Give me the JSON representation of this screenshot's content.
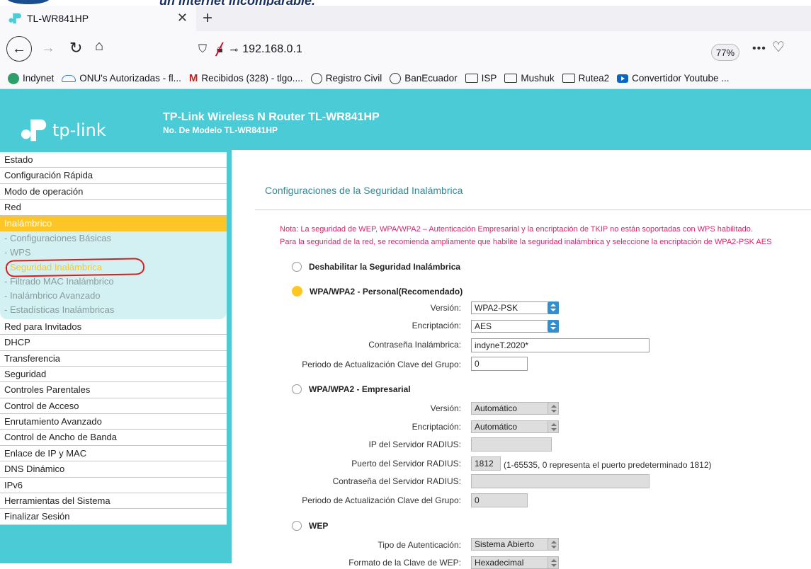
{
  "browser": {
    "tab_title": "TL-WR841HP",
    "url": "192.168.0.1",
    "zoom": "77%",
    "banner_text": "un internet incomparable."
  },
  "bookmarks": [
    {
      "label": "Indynet",
      "icon": "indynet-icon"
    },
    {
      "label": "ONU's Autorizadas - fl...",
      "icon": "onu-icon"
    },
    {
      "label": "Recibidos (328) - tlgo....",
      "icon": "gmail-icon"
    },
    {
      "label": "Registro Civil",
      "icon": "globe-icon"
    },
    {
      "label": "BanEcuador",
      "icon": "globe-icon"
    },
    {
      "label": "ISP",
      "icon": "folder-icon"
    },
    {
      "label": "Mushuk",
      "icon": "folder-icon"
    },
    {
      "label": "Rutea2",
      "icon": "folder-icon"
    },
    {
      "label": "Convertidor Youtube ...",
      "icon": "youtube-icon"
    }
  ],
  "header": {
    "logo_text": "tp-link",
    "title": "TP-Link Wireless N Router TL-WR841HP",
    "model": "No. De Modelo TL-WR841HP",
    "accent_color": "#4acbd6"
  },
  "sidebar": {
    "items_before": [
      "Estado",
      "Configuración Rápida",
      "Modo de operación",
      "Red"
    ],
    "active": "Inalámbrico",
    "subitems": [
      "- Configuraciones Básicas",
      "- WPS",
      "- Seguridad Inalámbrica",
      "- Filtrado MAC Inalámbrico",
      "- Inalámbrico Avanzado",
      "- Estadísticas Inalámbricas"
    ],
    "items_after": [
      "Red para Invitados",
      "DHCP",
      "Transferencia",
      "Seguridad",
      "Controles Parentales",
      "Control de Acceso",
      "Enrutamiento Avanzado",
      "Control de Ancho de Banda",
      "Enlace de IP y MAC",
      "DNS Dinámico",
      "IPv6",
      "Herramientas del Sistema",
      "Finalizar Sesión"
    ]
  },
  "main": {
    "title": "Configuraciones de la Seguridad Inalámbrica",
    "note1": "Nota: La seguridad de WEP, WPA/WPA2 – Autenticación Empresarial y la encriptación de TKIP no están soportadas con WPS habilitado.",
    "note2": "Para la seguridad de la red, se recomienda ampliamente que habilite la seguridad inalámbrica y seleccione la encriptación de WPA2-PSK AES",
    "disable_label": "Deshabilitar la Seguridad Inalámbrica",
    "personal": {
      "label": "WPA/WPA2 - Personal(Recomendado)",
      "version_label": "Versión:",
      "version_value": "WPA2-PSK",
      "encryption_label": "Encriptación:",
      "encryption_value": "AES",
      "password_label": "Contraseña Inalámbrica:",
      "password_value": "indyneT.2020*",
      "period_label": "Periodo de Actualización Clave del Grupo:",
      "period_value": "0"
    },
    "enterprise": {
      "label": "WPA/WPA2 - Empresarial",
      "version_label": "Versión:",
      "version_value": "Automático",
      "encryption_label": "Encriptación:",
      "encryption_value": "Automático",
      "radius_ip_label": "IP del Servidor RADIUS:",
      "radius_ip_value": "",
      "radius_port_label": "Puerto del Servidor RADIUS:",
      "radius_port_value": "1812",
      "radius_port_hint": "(1-65535, 0 representa el puerto predeterminado 1812)",
      "radius_pass_label": "Contraseña del Servidor RADIUS:",
      "radius_pass_value": "",
      "period_label": "Periodo de Actualización Clave del Grupo:",
      "period_value": "0"
    },
    "wep": {
      "label": "WEP",
      "auth_label": "Tipo de Autenticación:",
      "auth_value": "Sistema Abierto",
      "format_label": "Formato de la Clave de WEP:",
      "format_value": "Hexadecimal"
    }
  }
}
